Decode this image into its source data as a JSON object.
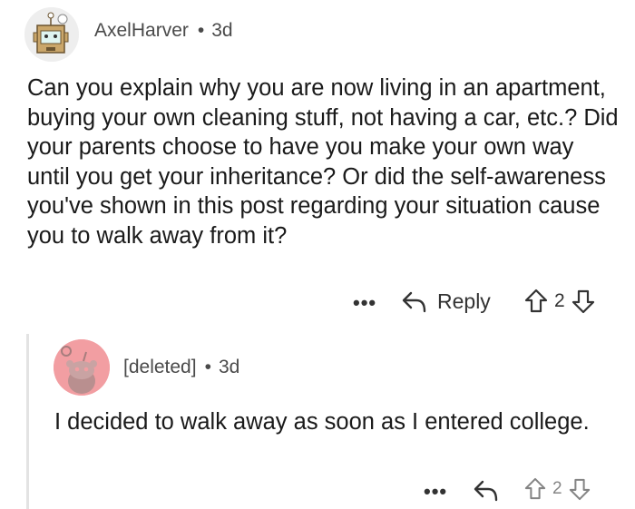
{
  "comment": {
    "username": "AxelHarver",
    "separator": "•",
    "age": "3d",
    "body": "Can you explain why you are now living in an apartment, buying your own cleaning stuff, not having a car, etc.? Did your parents choose to have you make your own way until you get your inheritance? Or did the self-awareness you've shown in this post regarding your situation cause you to walk away from it?",
    "more_label": "•••",
    "reply_label": "Reply",
    "vote_count": "2"
  },
  "reply": {
    "username": "[deleted]",
    "separator": "•",
    "age": "3d",
    "body": "I decided to walk away as soon as I entered college.",
    "more_label": "•••",
    "vote_count": "2"
  },
  "icons": {
    "reply": "reply-arrow-icon",
    "upvote": "upvote-arrow-icon",
    "downvote": "downvote-arrow-icon",
    "more": "more-dots-icon"
  },
  "colors": {
    "text": "#1a1a1a",
    "meta": "#4a4a4a",
    "deleted_avatar": "#f29ea2",
    "thread_line": "#e3e3e3"
  }
}
